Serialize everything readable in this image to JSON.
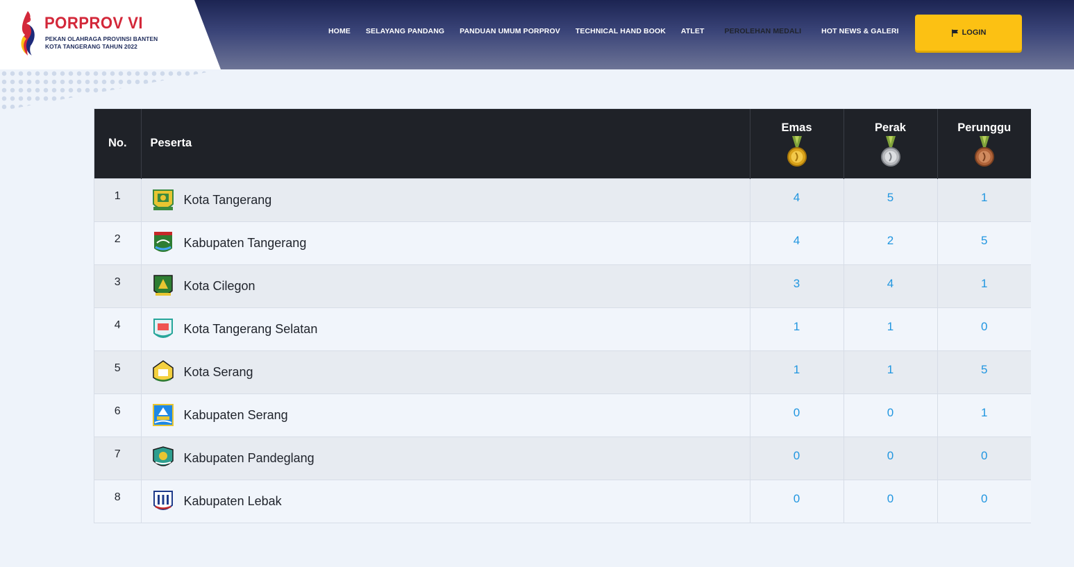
{
  "header": {
    "logo_title": "PORPROV VI",
    "logo_sub_1": "PEKAN OLAHRAGA PROVINSI BANTEN",
    "logo_sub_2": "KOTA TANGERANG TAHUN 2022",
    "nav": [
      {
        "label": "HOME",
        "active": false
      },
      {
        "label": "SELAYANG PANDANG",
        "active": false
      },
      {
        "label": "PANDUAN UMUM PORPROV",
        "active": false
      },
      {
        "label": "TECHNICAL HAND BOOK",
        "active": false
      },
      {
        "label": "ATLET",
        "active": false
      },
      {
        "label": "PEROLEHAN MEDALI",
        "active": true
      },
      {
        "label": "HOT NEWS & GALERI",
        "active": false
      }
    ],
    "login_label": "LOGIN",
    "login_icon": "flag-icon"
  },
  "colors": {
    "accent": "#fcc113",
    "header_dark": "#1f2228",
    "link_blue": "#2196e0",
    "brand_red": "#d3283a"
  },
  "table": {
    "headers": {
      "no": "No.",
      "peserta": "Peserta",
      "emas": "Emas",
      "perak": "Perak",
      "perunggu": "Perunggu"
    },
    "rows": [
      {
        "no": "1",
        "name": "Kota Tangerang",
        "emas": "4",
        "perak": "5",
        "perunggu": "1",
        "emblem": "kota-tangerang-emblem-icon"
      },
      {
        "no": "2",
        "name": "Kabupaten Tangerang",
        "emas": "4",
        "perak": "2",
        "perunggu": "5",
        "emblem": "kabupaten-tangerang-emblem-icon"
      },
      {
        "no": "3",
        "name": "Kota Cilegon",
        "emas": "3",
        "perak": "4",
        "perunggu": "1",
        "emblem": "kota-cilegon-emblem-icon"
      },
      {
        "no": "4",
        "name": "Kota Tangerang Selatan",
        "emas": "1",
        "perak": "1",
        "perunggu": "0",
        "emblem": "kota-tangerang-selatan-emblem-icon"
      },
      {
        "no": "5",
        "name": "Kota Serang",
        "emas": "1",
        "perak": "1",
        "perunggu": "5",
        "emblem": "kota-serang-emblem-icon"
      },
      {
        "no": "6",
        "name": "Kabupaten Serang",
        "emas": "0",
        "perak": "0",
        "perunggu": "1",
        "emblem": "kabupaten-serang-emblem-icon"
      },
      {
        "no": "7",
        "name": "Kabupaten Pandeglang",
        "emas": "0",
        "perak": "0",
        "perunggu": "0",
        "emblem": "kabupaten-pandeglang-emblem-icon"
      },
      {
        "no": "8",
        "name": "Kabupaten Lebak",
        "emas": "0",
        "perak": "0",
        "perunggu": "0",
        "emblem": "kabupaten-lebak-emblem-icon"
      }
    ]
  }
}
